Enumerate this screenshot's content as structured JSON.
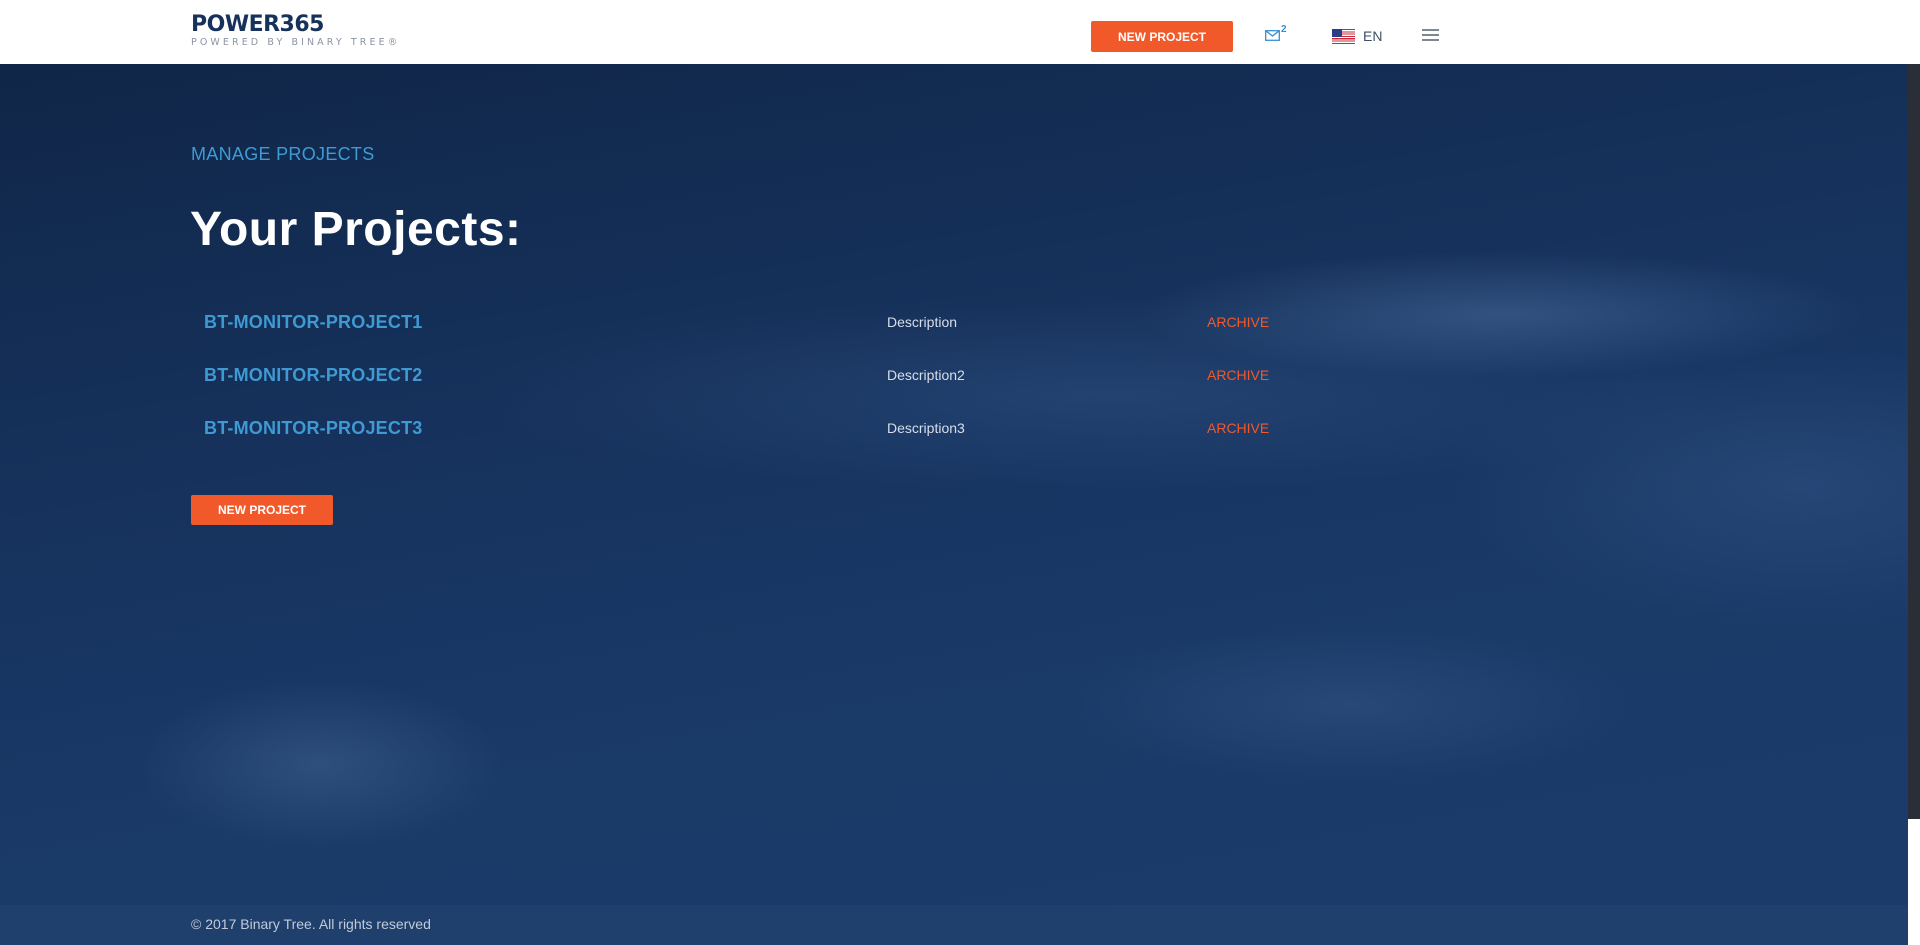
{
  "header": {
    "logo_main": "POWER365",
    "logo_sub": "POWERED BY BINARY TREE®",
    "new_project_label": "NEW PROJECT",
    "mail_icon": "envelope-icon",
    "mail_count": "2",
    "language_flag": "us-flag-icon",
    "language_label": "EN",
    "menu_icon": "hamburger-menu-icon"
  },
  "main": {
    "section_label": "MANAGE PROJECTS",
    "title": "Your Projects:",
    "projects": [
      {
        "name": "BT-MONITOR-PROJECT1",
        "description": "Description",
        "action": "ARCHIVE"
      },
      {
        "name": "BT-MONITOR-PROJECT2",
        "description": "Description2",
        "action": "ARCHIVE"
      },
      {
        "name": "BT-MONITOR-PROJECT3",
        "description": "Description3",
        "action": "ARCHIVE"
      }
    ],
    "new_project_label": "NEW PROJECT"
  },
  "footer": {
    "copyright": "© 2017 Binary Tree. All rights reserved"
  },
  "colors": {
    "accent": "#f1592a",
    "link": "#3f9ad4",
    "header_bg": "#ffffff",
    "brand_navy": "#17325a",
    "footer_bg": "#1f3f6c"
  }
}
